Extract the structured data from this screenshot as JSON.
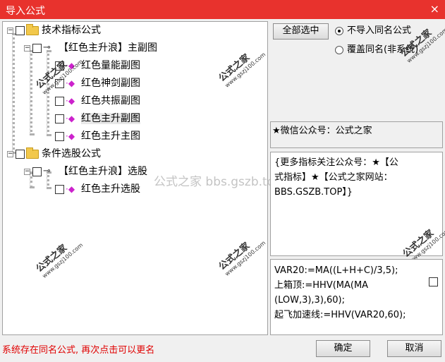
{
  "window": {
    "title": "导入公式",
    "close_icon": "×"
  },
  "tree": {
    "root1": {
      "label": "技术指标公式",
      "expander": "−"
    },
    "child1": {
      "label": "【红色主升浪】主副图",
      "expander": "−"
    },
    "leaves1": [
      {
        "label": "红色量能副图"
      },
      {
        "label": "红色神剑副图"
      },
      {
        "label": "红色共振副图"
      },
      {
        "label": "红色主升副图"
      },
      {
        "label": "红色主升主图"
      }
    ],
    "root2": {
      "label": "条件选股公式",
      "expander": "−"
    },
    "child2": {
      "label": "【红色主升浪】选股",
      "expander": "−"
    },
    "leaves2": [
      {
        "label": "红色主升选股"
      }
    ]
  },
  "controls": {
    "select_all": "全部选中",
    "radio_skip": "不导入同名公式",
    "radio_overwrite": "覆盖同名(非系统)"
  },
  "info": {
    "wechat": "★微信公众号：公式之家",
    "promo": [
      "{更多指标关注公众号：★【公",
      "式指标】★【公式之家网站：",
      "BBS.GSZB.TOP】}"
    ],
    "code": [
      "VAR20:=MA((L+H+C)/3,5);",
      "上箱顶:=HHV(MA(MA",
      "(LOW,3),3),60);",
      "起飞加速线:=HHV(VAR20,60);"
    ]
  },
  "buttons": {
    "ok": "确定",
    "cancel": "取消"
  },
  "status": "系统存在同名公式, 再次点击可以更名",
  "watermark": {
    "text": "公式之家",
    "url": "www.gszj100.com",
    "center": "公式之家 bbs.gszb.top"
  }
}
